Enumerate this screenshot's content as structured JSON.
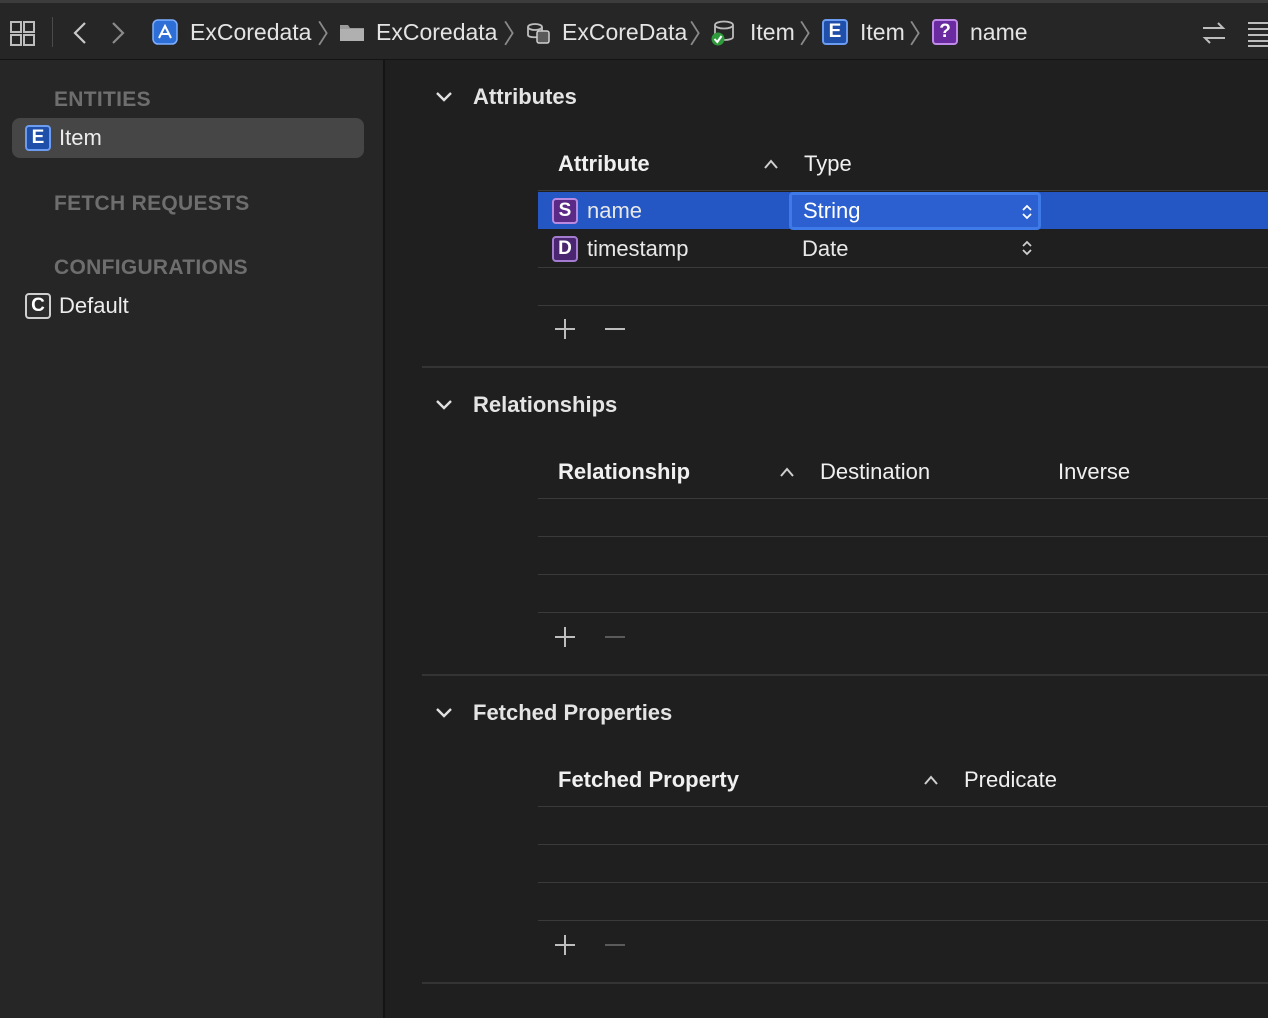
{
  "jumpbar": {
    "crumbs": [
      {
        "label": "ExCoredata",
        "icon": "app-project-icon"
      },
      {
        "label": "ExCoredata",
        "icon": "folder-icon"
      },
      {
        "label": "ExCoreData",
        "icon": "data-model-icon"
      },
      {
        "label": "Item",
        "icon": "model-version-check-icon"
      },
      {
        "label": "Item",
        "icon": "entity-icon",
        "badge": "E"
      },
      {
        "label": "name",
        "icon": "attribute-unknown-icon",
        "badge": "?"
      }
    ]
  },
  "sidebar": {
    "entities_header": "ENTITIES",
    "fetch_requests_header": "FETCH REQUESTS",
    "configurations_header": "CONFIGURATIONS",
    "entities": [
      {
        "badge": "E",
        "label": "Item"
      }
    ],
    "configurations": [
      {
        "badge": "C",
        "label": "Default"
      }
    ]
  },
  "attributes": {
    "title": "Attributes",
    "col_attribute": "Attribute",
    "col_type": "Type",
    "rows": [
      {
        "badge": "S",
        "name": "name",
        "type": "String"
      },
      {
        "badge": "D",
        "name": "timestamp",
        "type": "Date"
      }
    ]
  },
  "relationships": {
    "title": "Relationships",
    "col_relationship": "Relationship",
    "col_destination": "Destination",
    "col_inverse": "Inverse"
  },
  "fetched_properties": {
    "title": "Fetched Properties",
    "col_fetched_property": "Fetched Property",
    "col_predicate": "Predicate"
  },
  "colors": {
    "selection": "#2457c4",
    "popup_border": "#3e7ae8",
    "sidebar_selected": "#464646"
  }
}
